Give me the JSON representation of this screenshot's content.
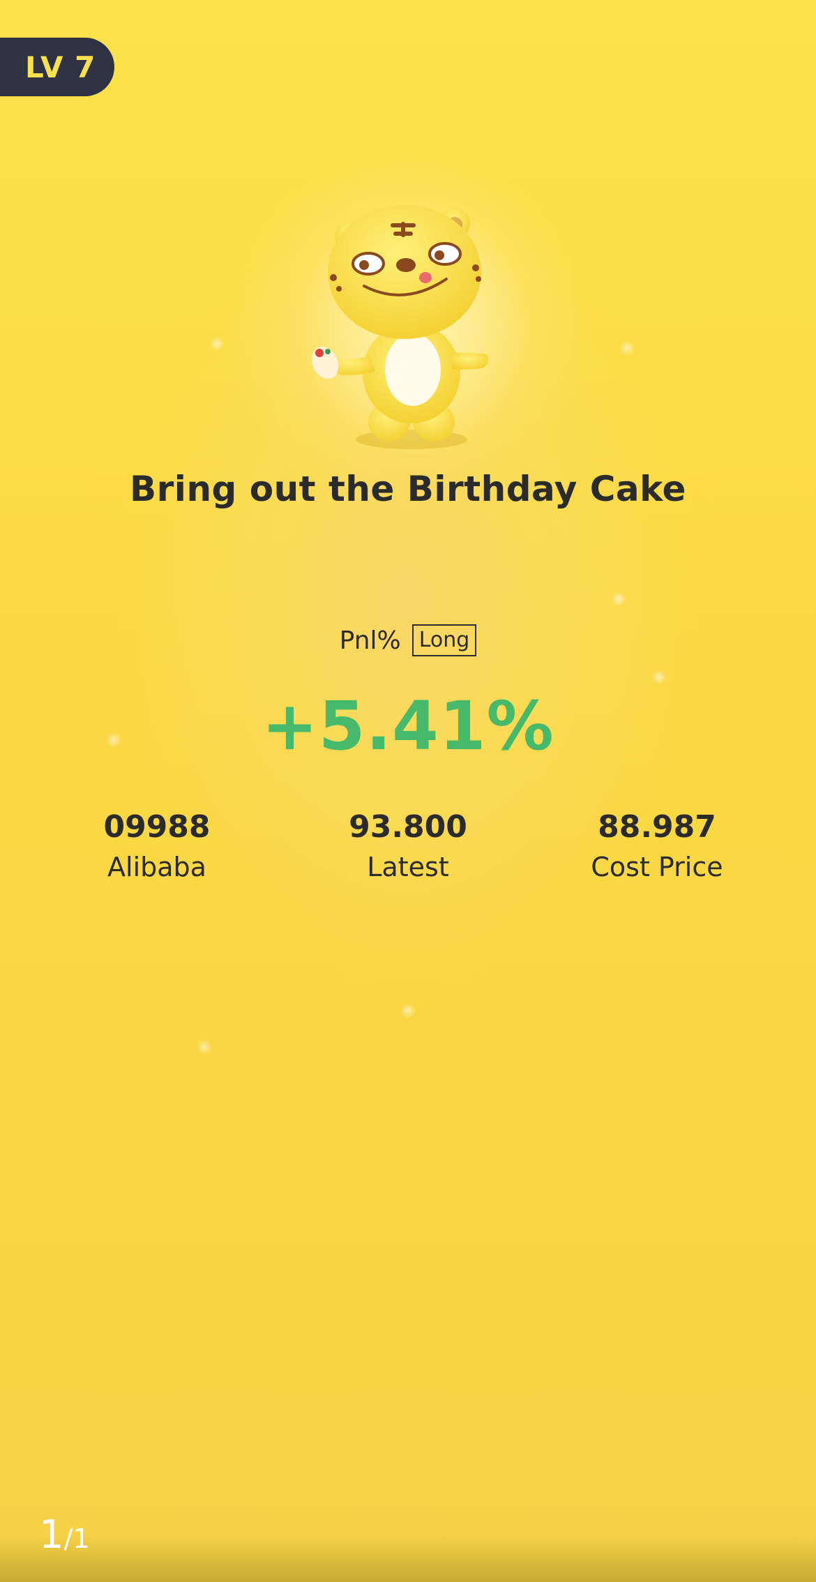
{
  "level": {
    "label": "LV 7"
  },
  "achievement": {
    "title": "Bring out the Birthday Cake",
    "mascot_icon": "tiger-mascot-icon"
  },
  "pnl": {
    "label": "Pnl%",
    "direction": "Long",
    "value": "+5.41%",
    "color": "#46b96b"
  },
  "stats": [
    {
      "value": "09988",
      "label": "Alibaba"
    },
    {
      "value": "93.800",
      "label": "Latest"
    },
    {
      "value": "88.987",
      "label": "Cost Price"
    }
  ],
  "pager": {
    "current": "1",
    "total": "/1"
  },
  "colors": {
    "background": "#fbd944",
    "badge_bg": "#2f3243",
    "badge_text": "#fbe14b",
    "text": "#2b2b2b"
  }
}
